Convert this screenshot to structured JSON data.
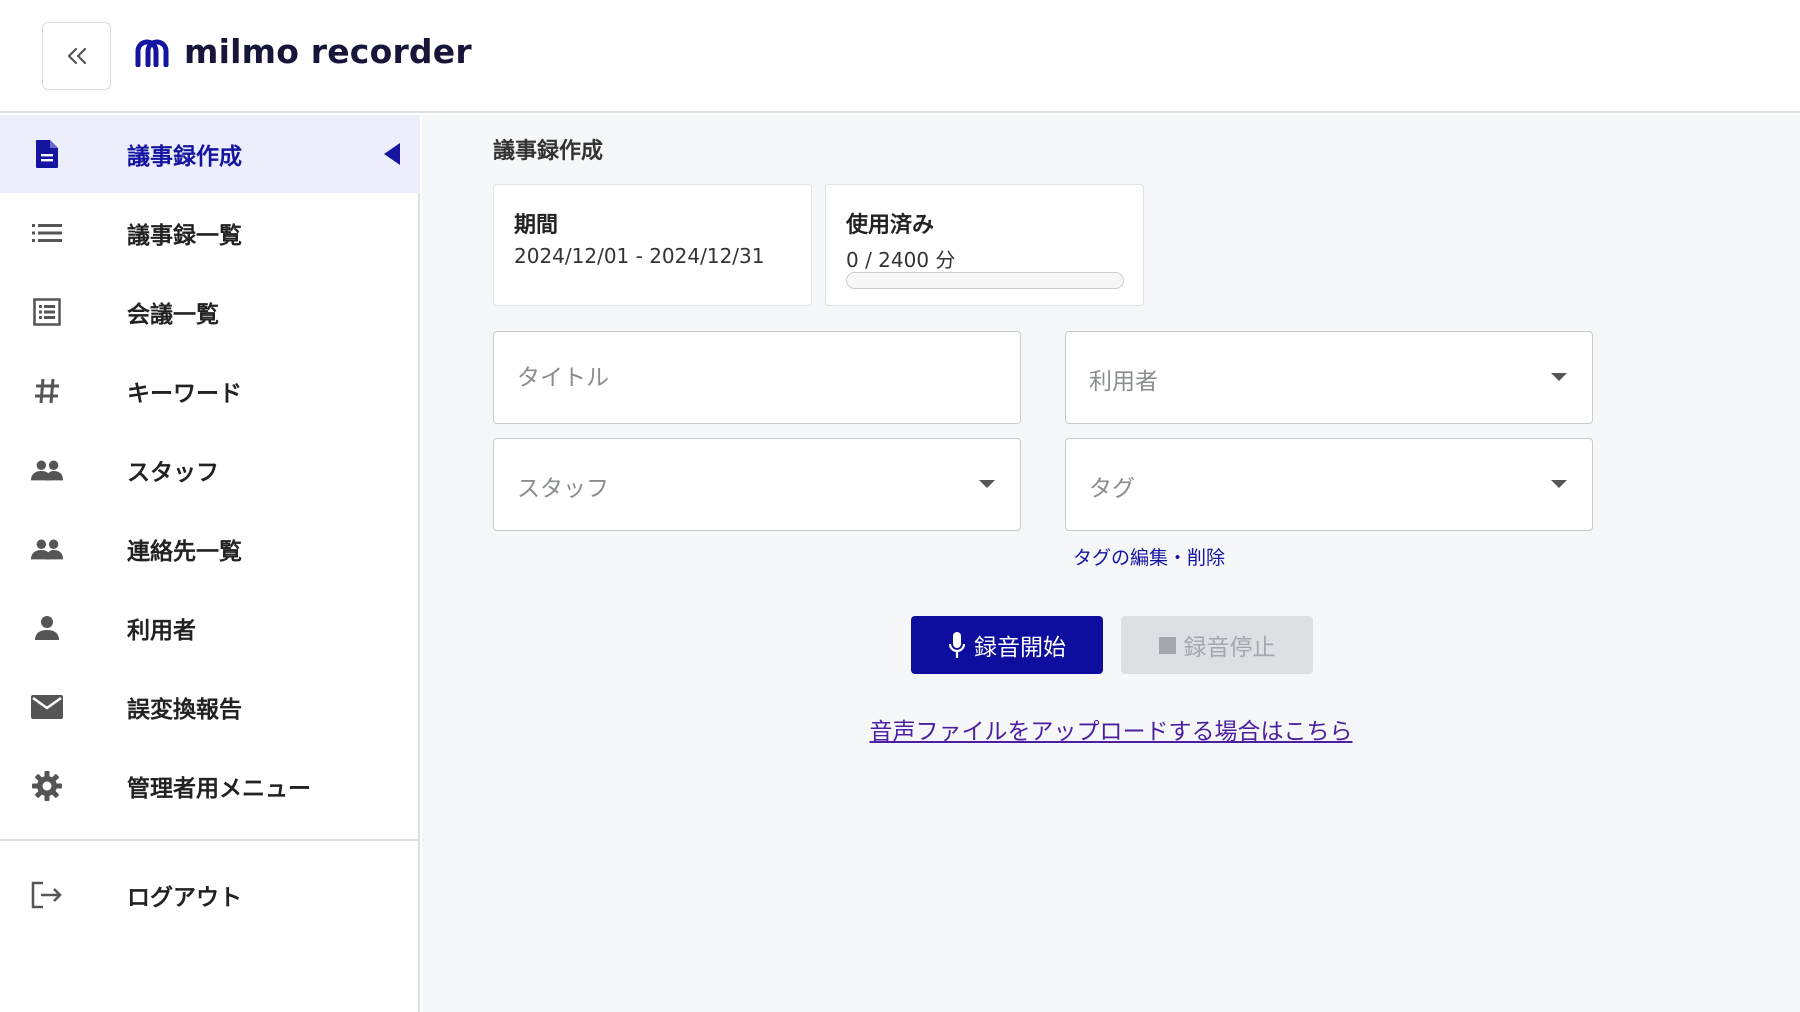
{
  "app": {
    "logo_text": "milmo recorder",
    "accent_color": "#1414a0"
  },
  "header": {
    "collapse_icon": "double-chevron-left-icon"
  },
  "sidebar": {
    "items": [
      {
        "label": "議事録作成",
        "icon": "document-icon",
        "active": true
      },
      {
        "label": "議事録一覧",
        "icon": "list-icon",
        "active": false
      },
      {
        "label": "会議一覧",
        "icon": "checklist-icon",
        "active": false
      },
      {
        "label": "キーワード",
        "icon": "hash-icon",
        "active": false
      },
      {
        "label": "スタッフ",
        "icon": "people-icon",
        "active": false
      },
      {
        "label": "連絡先一覧",
        "icon": "people-icon",
        "active": false
      },
      {
        "label": "利用者",
        "icon": "person-icon",
        "active": false
      },
      {
        "label": "誤変換報告",
        "icon": "mail-icon",
        "active": false
      },
      {
        "label": "管理者用メニュー",
        "icon": "gear-icon",
        "active": false
      }
    ],
    "logout_label": "ログアウト"
  },
  "main": {
    "title": "議事録作成",
    "period_card": {
      "title": "期間",
      "value": "2024/12/01 - 2024/12/31"
    },
    "usage_card": {
      "title": "使用済み",
      "value": "0 / 2400 分",
      "progress": 0
    },
    "form": {
      "title_placeholder": "タイトル",
      "user_placeholder": "利用者",
      "staff_placeholder": "スタッフ",
      "tag_placeholder": "タグ"
    },
    "tag_edit_link": "タグの編集・削除",
    "record_start_label": "録音開始",
    "record_stop_label": "録音停止",
    "upload_link": "音声ファイルをアップロードする場合はこちら"
  }
}
